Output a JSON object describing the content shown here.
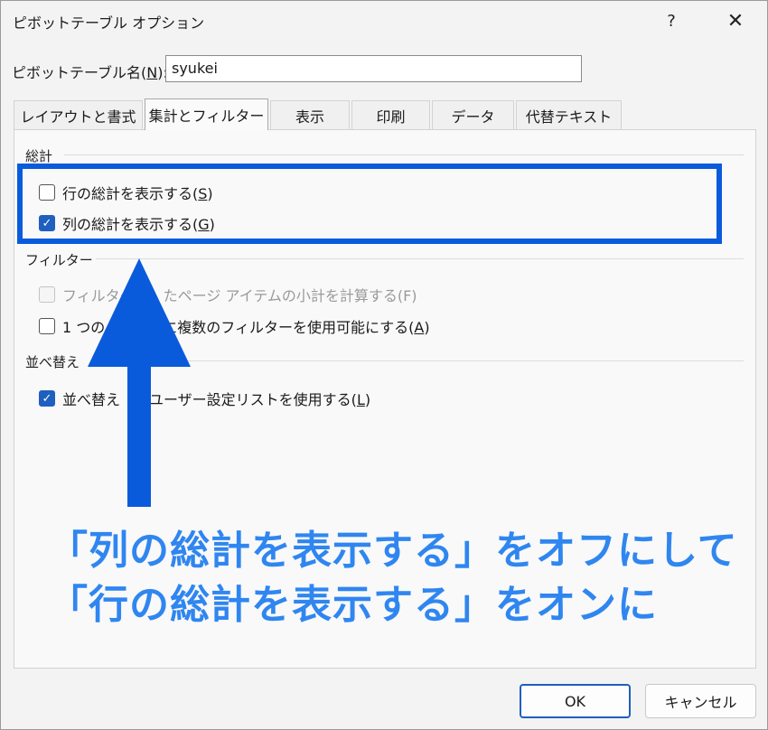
{
  "window": {
    "title": "ピボットテーブル オプション",
    "help": "?",
    "close": "✕"
  },
  "name_field": {
    "label": "ピボットテーブル名(",
    "mnemonic": "N",
    "label_end": "):",
    "value": "syukei"
  },
  "tabs": [
    {
      "label": "レイアウトと書式"
    },
    {
      "label": "集計とフィルター"
    },
    {
      "label": "表示"
    },
    {
      "label": "印刷"
    },
    {
      "label": "データ"
    },
    {
      "label": "代替テキスト"
    }
  ],
  "sections": {
    "totals": {
      "label": "総計",
      "row_totals": {
        "text": "行の総計を表示する(",
        "key": "S",
        "end": ")",
        "checked": false
      },
      "col_totals": {
        "text": "列の総計を表示する(",
        "key": "G",
        "end": ")",
        "checked": true
      }
    },
    "filters": {
      "label": "フィルター",
      "subtotal_filtered": {
        "text": "フィルター　　たページ アイテムの小計を計算する(F)",
        "checked": false,
        "disabled": true
      },
      "multiple_filters": {
        "text": "1 つの　　　　に複数のフィルターを使用可能にする(",
        "key": "A",
        "end": ")",
        "checked": false
      }
    },
    "sorting": {
      "label": "並べ替え",
      "custom_lists": {
        "text": "並べ替え　にユーザー設定リストを使用する(",
        "key": "L",
        "end": ")",
        "checked": true
      }
    }
  },
  "annotation": {
    "line1": "「列の総計を表示する」をオフにして",
    "line2": "「行の総計を表示する」をオンに"
  },
  "buttons": {
    "ok": "OK",
    "cancel": "キャンセル"
  },
  "colors": {
    "highlight": "#0a5bdc",
    "annotation_text": "#2f86f0",
    "checkbox_checked": "#1f5fbf"
  }
}
